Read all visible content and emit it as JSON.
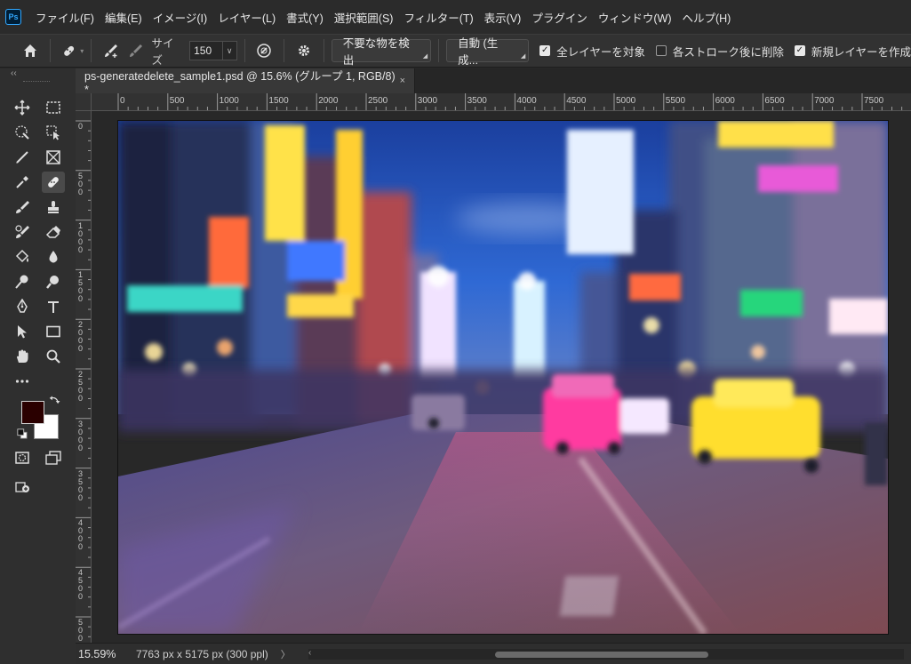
{
  "app": {
    "logo_text": "Ps"
  },
  "menu": [
    "ファイル(F)",
    "編集(E)",
    "イメージ(I)",
    "レイヤー(L)",
    "書式(Y)",
    "選択範囲(S)",
    "フィルター(T)",
    "表示(V)",
    "プラグイン",
    "ウィンドウ(W)",
    "ヘルプ(H)"
  ],
  "options": {
    "size_label": "サイズ",
    "size_value": "150",
    "mode_dropdown": "不要な物を検出",
    "auto_dropdown": "自動 (生成...",
    "checkboxes": [
      {
        "label": "全レイヤーを対象",
        "checked": true
      },
      {
        "label": "各ストローク後に削除",
        "checked": false
      },
      {
        "label": "新規レイヤーを作成",
        "checked": true
      }
    ]
  },
  "document": {
    "tab_title": "ps-generatedelete_sample1.psd @ 15.6% (グループ 1, RGB/8) *",
    "close_glyph": "×"
  },
  "ruler": {
    "top_labels": [
      "0",
      "500",
      "1000",
      "1500",
      "2000",
      "2500",
      "3000",
      "3500",
      "4000",
      "4500",
      "5000",
      "5500",
      "6000",
      "6500",
      "7000",
      "7500"
    ],
    "left_labels": [
      "0",
      "5\n0\n0",
      "1\n0\n0\n0",
      "1\n5\n0\n0",
      "2\n0\n0\n0",
      "2\n5\n0\n0",
      "3\n0\n0\n0",
      "3\n5\n0\n0",
      "4\n0\n0\n0",
      "4\n5\n0\n0",
      "5\n0\n0\n0"
    ]
  },
  "status": {
    "zoom": "15.59%",
    "doc_info": "7763 px x 5175 px (300 ppl)",
    "arrow": "〉"
  },
  "colors": {
    "foreground": "#2a0000",
    "background": "#ffffff",
    "accent": "#31a8ff"
  }
}
